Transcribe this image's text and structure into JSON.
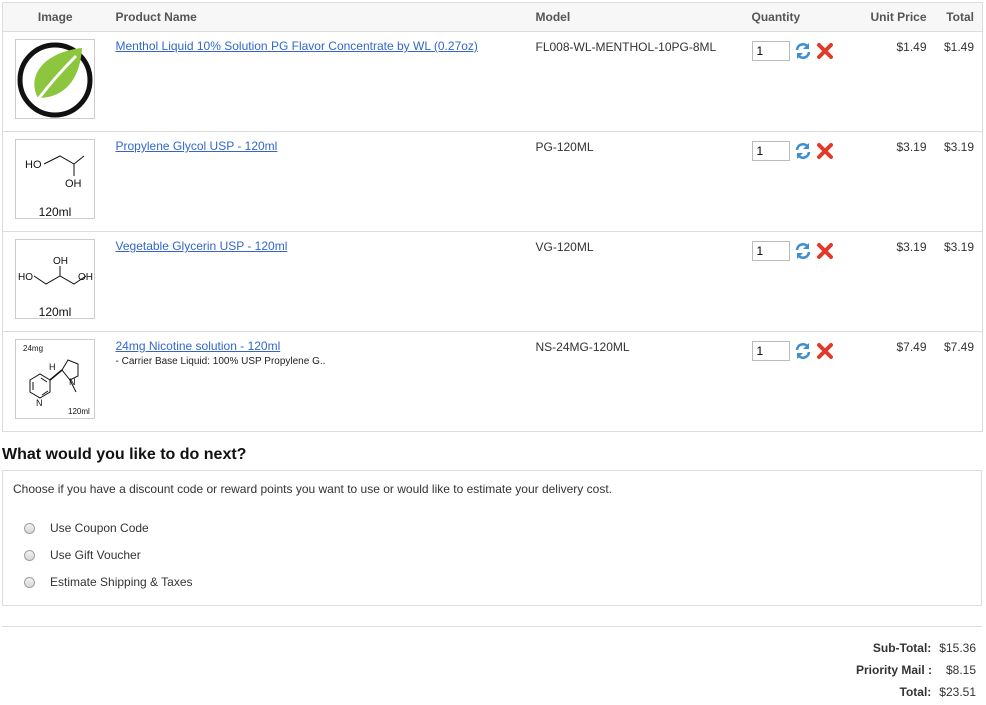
{
  "table": {
    "headers": {
      "image": "Image",
      "product_name": "Product Name",
      "model": "Model",
      "quantity": "Quantity",
      "unit_price": "Unit Price",
      "total": "Total"
    },
    "rows": [
      {
        "name": "Menthol Liquid 10% Solution PG Flavor Concentrate by WL (0.27oz)",
        "option": "",
        "model": "FL008-WL-MENTHOL-10PG-8ML",
        "quantity": "1",
        "unit_price": "$1.49",
        "total": "$1.49",
        "image": {
          "icon": "leaf-logo-icon",
          "caption": "",
          "tag": ""
        }
      },
      {
        "name": "Propylene Glycol USP - 120ml",
        "option": "",
        "model": "PG-120ML",
        "quantity": "1",
        "unit_price": "$3.19",
        "total": "$3.19",
        "image": {
          "icon": "propylene-glycol-structure-icon",
          "caption": "120ml",
          "tag": "",
          "labels": [
            "HO",
            "OH"
          ]
        }
      },
      {
        "name": "Vegetable Glycerin USP - 120ml",
        "option": "",
        "model": "VG-120ML",
        "quantity": "1",
        "unit_price": "$3.19",
        "total": "$3.19",
        "image": {
          "icon": "glycerin-structure-icon",
          "caption": "120ml",
          "tag": "",
          "labels": [
            "OH",
            "HO",
            "OH"
          ]
        }
      },
      {
        "name": "24mg Nicotine solution - 120ml",
        "option": "- Carrier Base Liquid: 100% USP Propylene G..",
        "model": "NS-24MG-120ML",
        "quantity": "1",
        "unit_price": "$7.49",
        "total": "$7.49",
        "image": {
          "icon": "nicotine-structure-icon",
          "caption": "120ml",
          "tag": "24mg",
          "labels": [
            "H",
            "N",
            "N"
          ]
        }
      }
    ]
  },
  "next_step": {
    "heading": "What would you like to do next?",
    "description": "Choose if you have a discount code or reward points you want to use or would like to estimate your delivery cost.",
    "options": [
      "Use Coupon Code",
      "Use Gift Voucher",
      "Estimate Shipping & Taxes"
    ]
  },
  "totals": [
    {
      "label": "Sub-Total:",
      "value": "$15.36"
    },
    {
      "label": "Priority Mail :",
      "value": "$8.15"
    },
    {
      "label": "Total:",
      "value": "$23.51"
    }
  ],
  "colors": {
    "link": "#3366cc",
    "update_icon": "#3d8fd1",
    "remove_icon": "#e23a2a",
    "leaf_green": "#8cc63f"
  }
}
